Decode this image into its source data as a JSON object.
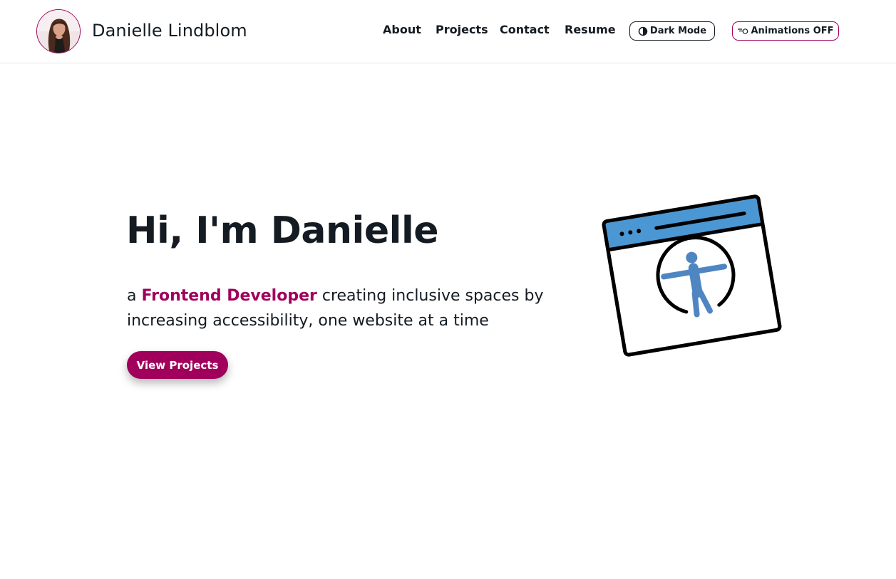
{
  "header": {
    "site_name": "Danielle Lindblom",
    "avatar_alt": "Photo of Danielle Lindblom",
    "nav": [
      {
        "label": "About"
      },
      {
        "label": "Projects"
      },
      {
        "label": "Contact"
      },
      {
        "label": "Resume"
      }
    ],
    "dark_mode": {
      "label": "Dark Mode",
      "icon": "contrast-icon"
    },
    "animations": {
      "label": "Animations OFF",
      "icon": "animation-icon"
    }
  },
  "hero": {
    "title": "Hi, I'm Danielle",
    "subtitle_prefix": "a ",
    "subtitle_accent": "Frontend Developer",
    "subtitle_suffix": " creating inclusive spaces by increasing accessibility, one website at a time",
    "cta_label": "View Projects",
    "illustration_icon": "accessibility-browser-icon"
  },
  "colors": {
    "accent": "#a0005c",
    "text": "#141b22",
    "illustration_blue": "#4a97d3",
    "figure_blue": "#4f86c2"
  }
}
